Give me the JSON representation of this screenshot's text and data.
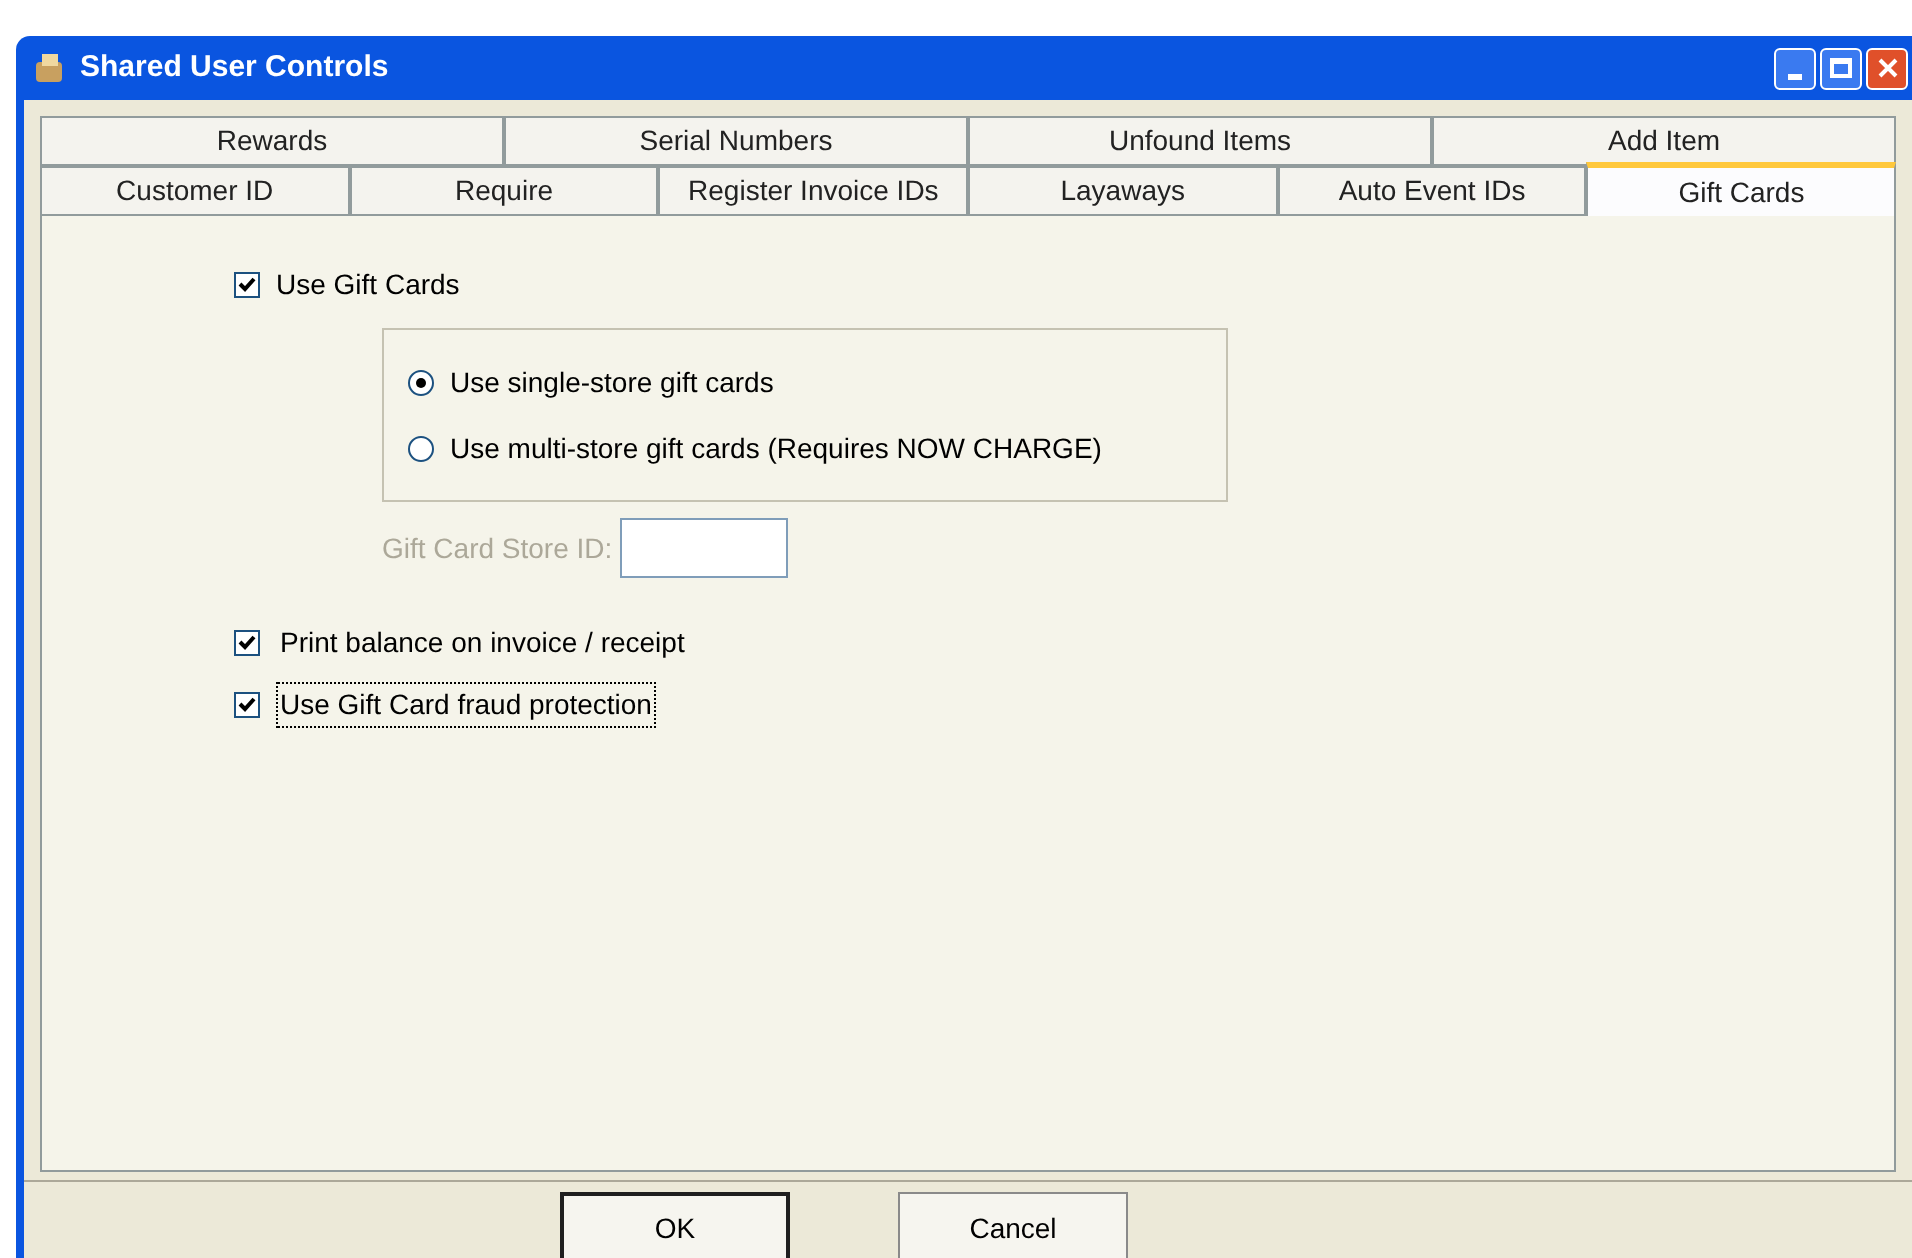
{
  "window": {
    "title": "Shared User Controls"
  },
  "tab_rows": [
    [
      {
        "label": "Rewards",
        "selected": false
      },
      {
        "label": "Serial Numbers",
        "selected": false
      },
      {
        "label": "Unfound Items",
        "selected": false
      },
      {
        "label": "Add Item",
        "selected": false
      }
    ],
    [
      {
        "label": "Customer ID",
        "selected": false
      },
      {
        "label": "Require",
        "selected": false
      },
      {
        "label": "Register Invoice IDs",
        "selected": false
      },
      {
        "label": "Layaways",
        "selected": false
      },
      {
        "label": "Auto Event IDs",
        "selected": false
      },
      {
        "label": "Gift Cards",
        "selected": true
      }
    ]
  ],
  "use_gift_cards": {
    "label": "Use Gift Cards",
    "checked": true
  },
  "radios": [
    {
      "label": "Use single-store gift cards",
      "selected": true
    },
    {
      "label": "Use multi-store gift cards (Requires NOW CHARGE)",
      "selected": false
    }
  ],
  "store_id": {
    "label": "Gift Card Store ID:",
    "disabled": true
  },
  "options": [
    {
      "label": "Print balance on invoice / receipt",
      "checked": true,
      "focused": false
    },
    {
      "label": "Use Gift Card fraud protection",
      "checked": true,
      "focused": true
    }
  ],
  "buttons": [
    {
      "label": "OK",
      "default": true
    },
    {
      "label": "Cancel",
      "default": false
    }
  ]
}
